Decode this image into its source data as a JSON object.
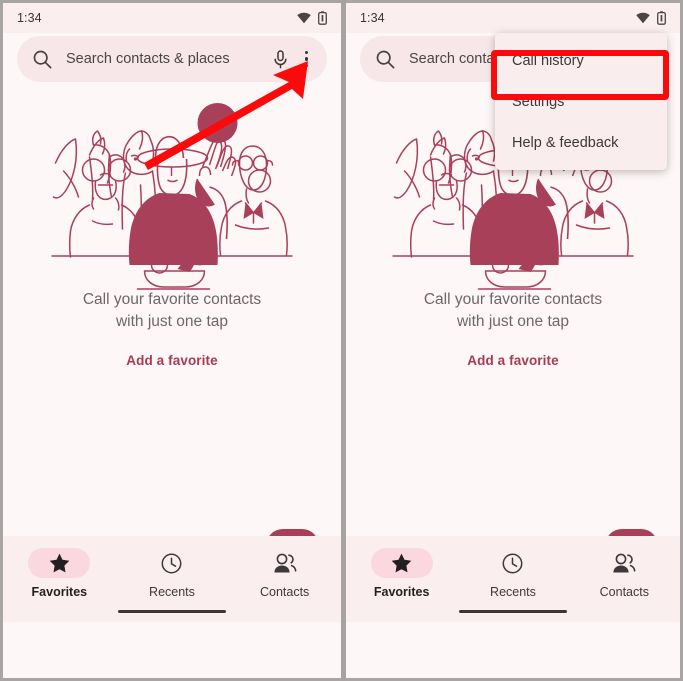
{
  "meta": {
    "app": "Google Phone",
    "screen": "Favorites empty state",
    "accent_color": "#a93e58",
    "background_color": "#fdf7f7",
    "surface_color": "#faeeee",
    "search_chip_color": "#f7e7e8",
    "annotation_color": "#fa0a0a"
  },
  "status_bar": {
    "time": "1:34",
    "icons": [
      "wifi-icon",
      "battery-icon"
    ]
  },
  "search": {
    "placeholder_full": "Search contacts & places",
    "placeholder_truncated": "Search contact",
    "leading_icon": "search-icon",
    "mic_icon": "mic-icon",
    "overflow_icon": "kebab-menu-icon"
  },
  "empty_state": {
    "title_line1": "Call your favorite contacts",
    "title_line2": "with just one tap",
    "action_label": "Add a favorite"
  },
  "fab": {
    "name": "dialpad-button",
    "icon": "dialpad-icon"
  },
  "bottom_nav": {
    "items": [
      {
        "label": "Favorites",
        "icon": "star-icon",
        "active": true
      },
      {
        "label": "Recents",
        "icon": "clock-icon",
        "active": false
      },
      {
        "label": "Contacts",
        "icon": "people-icon",
        "active": false
      }
    ]
  },
  "overflow_menu": {
    "items": [
      {
        "label": "Call history",
        "highlighted": false
      },
      {
        "label": "Settings",
        "highlighted": true
      },
      {
        "label": "Help & feedback",
        "highlighted": false
      }
    ]
  },
  "annotations": {
    "arrow": {
      "name": "pointer-arrow",
      "target": "kebab-menu-icon"
    },
    "box": {
      "name": "highlight-box",
      "target": "Settings"
    }
  }
}
